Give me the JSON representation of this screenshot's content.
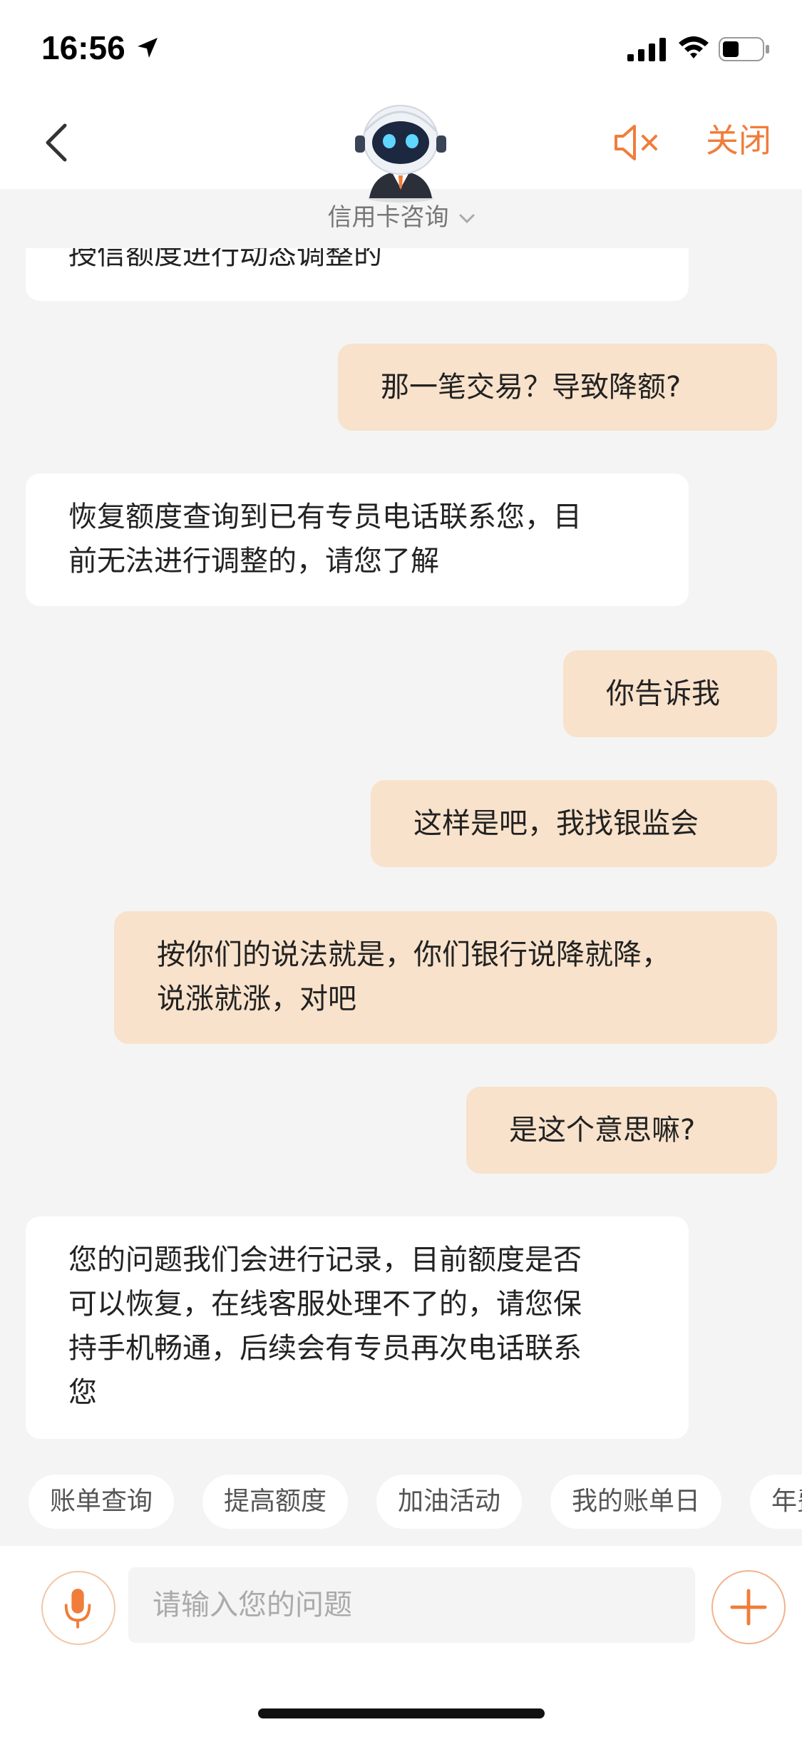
{
  "status_bar": {
    "time": "16:56"
  },
  "nav": {
    "close_label": "关闭",
    "service_title": "信用卡咨询"
  },
  "colors": {
    "accent": "#f07d3a",
    "user_bubble": "#f8e2cb",
    "agent_bubble": "#ffffff",
    "background": "#f4f4f4"
  },
  "messages": [
    {
      "role": "agent",
      "text": "授信额度进行动态调整的"
    },
    {
      "role": "user",
      "text": "那一笔交易？导致降额?"
    },
    {
      "role": "agent",
      "text": "恢复额度查询到已有专员电话联系您，目\n前无法进行调整的，请您了解"
    },
    {
      "role": "user",
      "text": "你告诉我"
    },
    {
      "role": "user",
      "text": "这样是吧，我找银监会"
    },
    {
      "role": "user",
      "text": "按你们的说法就是，你们银行说降就降，\n说涨就涨，对吧"
    },
    {
      "role": "user",
      "text": "是这个意思嘛?"
    },
    {
      "role": "agent",
      "text": "您的问题我们会进行记录，目前额度是否\n可以恢复，在线客服处理不了的，请您保\n持手机畅通，后续会有专员再次电话联系\n您"
    }
  ],
  "quick_tags": [
    "账单查询",
    "提高额度",
    "加油活动",
    "我的账单日",
    "年费"
  ],
  "input": {
    "placeholder": "请输入您的问题",
    "value": ""
  }
}
